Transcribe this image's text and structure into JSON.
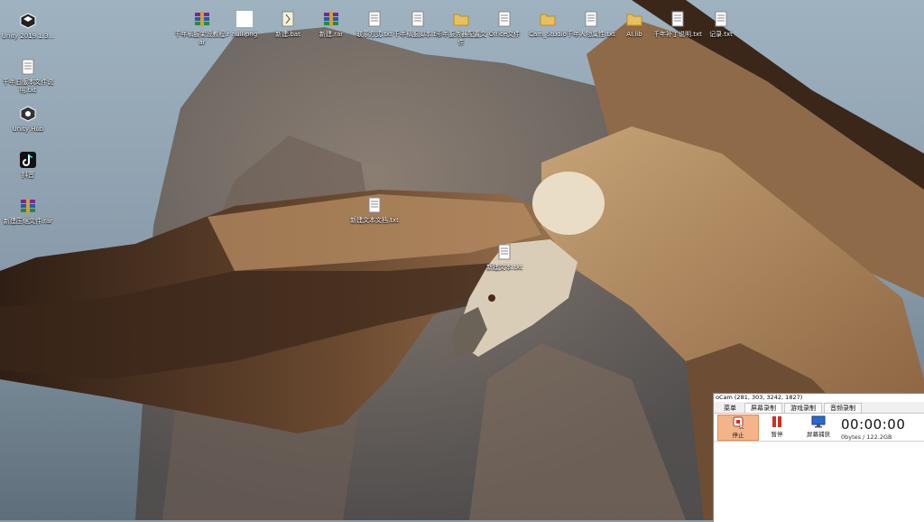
{
  "desktop": {
    "left_icons": [
      {
        "label": "Unity 2019.1.3...",
        "icon": "unity-icon"
      },
      {
        "label": "千年旧版本文件说明.txt",
        "icon": "text-file-icon"
      },
      {
        "label": "Unity Hub",
        "icon": "unity-hub-icon"
      },
      {
        "label": "抖音",
        "icon": "tiktok-icon"
      },
      {
        "label": "新建压缩文件.rar",
        "icon": "winrar-icon"
      }
    ],
    "top_icons": [
      {
        "label": "千年私服架设教程.rar",
        "icon": "winrar-icon"
      },
      {
        "label": "null.png",
        "icon": "image-file-icon"
      },
      {
        "label": "新建.bat",
        "icon": "bat-file-icon"
      },
      {
        "label": "新建.rar",
        "icon": "winrar-icon"
      },
      {
        "label": "联系方式.txt",
        "icon": "text-file-icon"
      },
      {
        "label": "千年私服脚本.txt",
        "icon": "text-file-icon"
      },
      {
        "label": "千年服务器配置文件",
        "icon": "folder-icon"
      },
      {
        "label": "Office文件",
        "icon": "text-file-icon"
      },
      {
        "label": "Cam_Studio",
        "icon": "folder-icon"
      },
      {
        "label": "千年人物属性.txt",
        "icon": "text-file-icon"
      },
      {
        "label": "AI.lib",
        "icon": "folder-icon"
      },
      {
        "label": "千年补丁说明.txt",
        "icon": "text-file-icon"
      },
      {
        "label": "记录.txt",
        "icon": "text-file-icon"
      }
    ],
    "middle_icons": [
      {
        "label": "新建文本文档.txt",
        "icon": "text-file-icon"
      },
      {
        "label": "新建文本.txt",
        "icon": "text-file-icon"
      }
    ]
  },
  "recorder": {
    "title": "oCam (281, 303, 3242, 1827)",
    "tabs": [
      "菜单",
      "屏幕录制",
      "游戏录制",
      "音频录制"
    ],
    "buttons": [
      {
        "label": "停止",
        "icon": "stop-record-icon"
      },
      {
        "label": "暂停",
        "icon": "pause-icon"
      },
      {
        "label": "屏幕捕获",
        "icon": "screen-capture-icon"
      }
    ],
    "timer": "00:00:00",
    "info": "0bytes / 122.2GB"
  },
  "colors": {
    "recorder_pressed": "#f3b48a",
    "recorder_bg": "#f0f0f0"
  }
}
